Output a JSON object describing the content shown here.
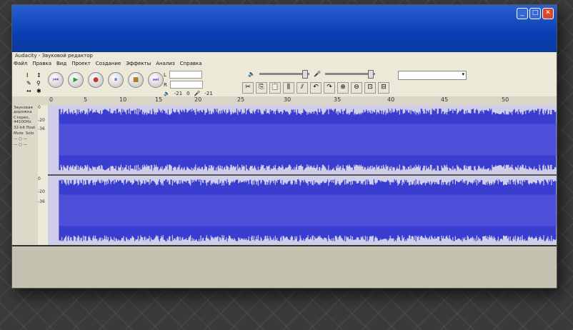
{
  "window": {
    "title": "Audacity - Звуковой редактор",
    "buttons": {
      "minimize": "_",
      "maximize": "□",
      "close": "✕"
    }
  },
  "menu": [
    "Файл",
    "Правка",
    "Вид",
    "Проект",
    "Создание",
    "Эффекты",
    "Анализ",
    "Справка"
  ],
  "toolbar": {
    "meter_left_label": "L",
    "meter_right_label": "R",
    "meter_left_value": "-21",
    "meter_right_value": "-21",
    "meter_zero": "0"
  },
  "ruler": {
    "ticks": [
      "5",
      "10",
      "15",
      "20",
      "25",
      "30",
      "35",
      "40",
      "45",
      "50"
    ],
    "start": "0"
  },
  "track": {
    "name": "Звуковая дорожка",
    "info_line1": "Стерео, 44100Hz",
    "info_line2": "32-bit float",
    "mute": "Mute",
    "solo": "Solo",
    "db_top": "0",
    "db_mid": "-20",
    "db_low": "-36"
  },
  "colors": {
    "waveform": "#3a3ed0",
    "waveform_bg": "#cfcde8",
    "titlebar": "#0a3fb5"
  }
}
